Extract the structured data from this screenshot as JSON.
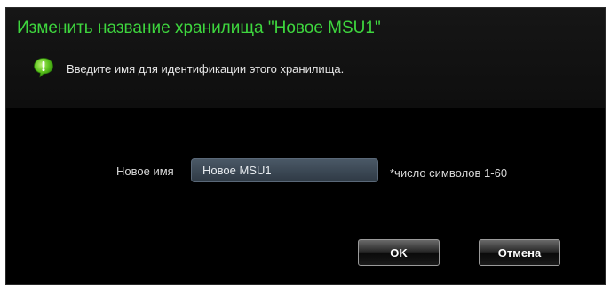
{
  "dialog": {
    "title": "Изменить название хранилища \"Новое MSU1\"",
    "hint": "Введите имя для идентификации этого хранилища.",
    "hint_icon": "info-bubble-icon",
    "title_color": "#3ed63e"
  },
  "form": {
    "name_label": "Новое имя",
    "name_value": "Новое MSU1",
    "name_note": "*число символов 1-60"
  },
  "buttons": {
    "ok_label": "OK",
    "cancel_label": "Отмена"
  }
}
